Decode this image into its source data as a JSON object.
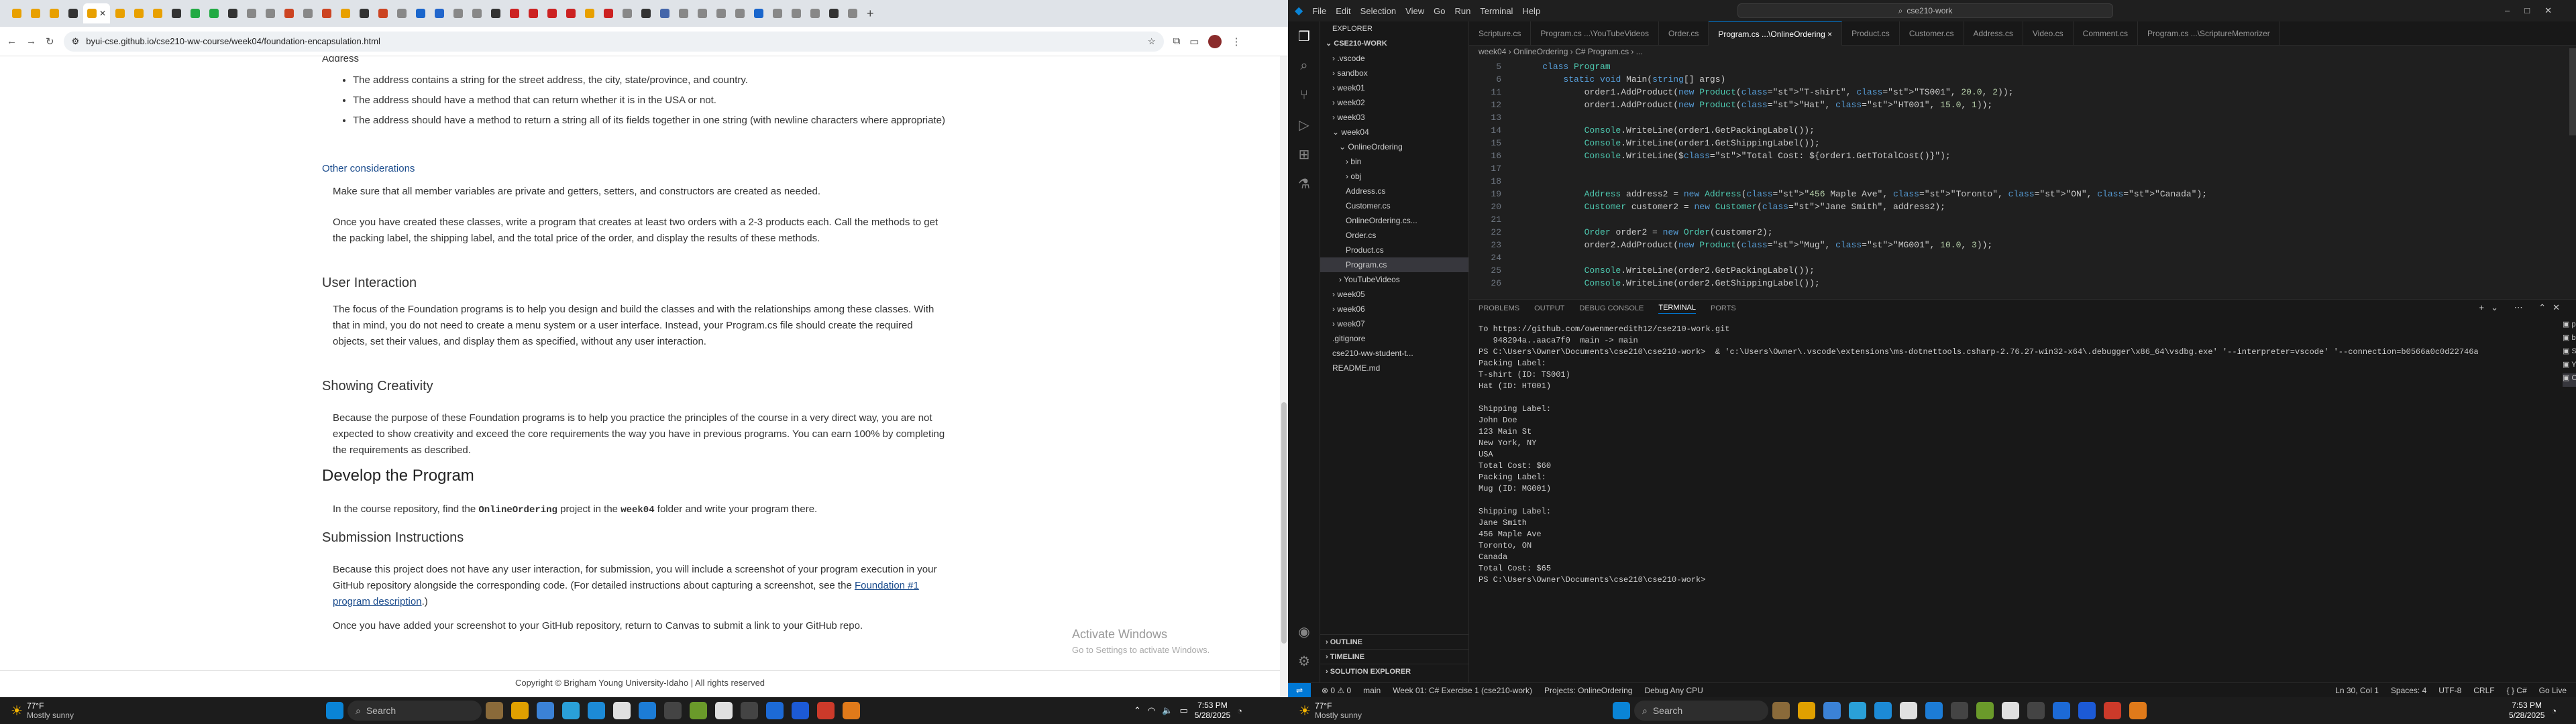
{
  "browser": {
    "url": "byui-cse.github.io/cse210-ww-course/week04/foundation-encapsulation.html",
    "tab_colors": [
      "#e8a000",
      "#e8a000",
      "#e8a000",
      "#333333",
      "#e8a000",
      "#e8a000",
      "#e8a000",
      "#e8a000",
      "#333333",
      "#22aa44",
      "#22aa44",
      "#333333",
      "#888888",
      "#888888",
      "#cc4422",
      "#888888",
      "#cc4422",
      "#e8a000",
      "#333333",
      "#cc4422",
      "#888888",
      "#1a66cc",
      "#2266cc",
      "#888888",
      "#888888",
      "#333333",
      "#cc2222",
      "#cc2222",
      "#cc2222",
      "#cc2222",
      "#e8a000",
      "#cc2222",
      "#888888",
      "#333333",
      "#4466aa",
      "#888888",
      "#888888",
      "#888888",
      "#888888",
      "#1a66cc",
      "#888888",
      "#888888",
      "#888888",
      "#333333",
      "#888888"
    ]
  },
  "doc": {
    "heading_address": "Address",
    "address_bullets": [
      "The address contains a string for the street address, the city, state/province, and country.",
      "The address should have a method that can return whether it is in the USA or not.",
      "The address should have a method to return a string all of its fields together in one string (with newline characters where appropriate)"
    ],
    "other_considerations": "Other considerations",
    "other_p1": "Make sure that all member variables are private and getters, setters, and constructors are created as needed.",
    "other_p2": "Once you have created these classes, write a program that creates at least two orders with a 2-3 products each. Call the methods to get the packing label, the shipping label, and the total price of the order, and display the results of these methods.",
    "user_interaction": "User Interaction",
    "ui_p": "The focus of the Foundation programs is to help you design and build the classes and with the relationships among these classes. With that in mind, you do not need to create a menu system or a user interface. Instead, your Program.cs file should create the required objects, set their values, and display them as specified, without any user interaction.",
    "showing_creativity": "Showing Creativity",
    "sc_p": "Because the purpose of these Foundation programs is to help you practice the principles of the course in a very direct way, you are not expected to show creativity and exceed the core requirements the way you have in previous programs. You can earn 100% by completing the requirements as described.",
    "develop": "Develop the Program",
    "dev_p_a": "In the course repository, find the ",
    "dev_code1": "OnlineOrdering",
    "dev_p_b": " project in the ",
    "dev_code2": "week04",
    "dev_p_c": " folder and write your program there.",
    "submission": "Submission Instructions",
    "sub_p1_a": "Because this project does not have any user interaction, for submission, you will include a screenshot of your program execution in your GitHub repository alongside the corresponding code. (For detailed instructions about capturing a screenshot, see the ",
    "sub_p1_link": "Foundation #1 program description",
    "sub_p1_c": ".)",
    "sub_p2": "Once you have added your screenshot to your GitHub repository, return to Canvas to submit a link to your GitHub repo.",
    "footer": "Copyright © Brigham Young University-Idaho | All rights reserved",
    "watermark_title": "Activate Windows",
    "watermark_sub": "Go to Settings to activate Windows."
  },
  "vscode": {
    "menu": [
      "File",
      "Edit",
      "Selection",
      "View",
      "Go",
      "Run",
      "Terminal",
      "Help"
    ],
    "command_center": "cse210-work",
    "explorer_title": "EXPLORER",
    "root": "CSE210-WORK",
    "tree": [
      {
        "label": "› .vscode",
        "indent": 1
      },
      {
        "label": "› sandbox",
        "indent": 1
      },
      {
        "label": "› week01",
        "indent": 1
      },
      {
        "label": "› week02",
        "indent": 1
      },
      {
        "label": "› week03",
        "indent": 1
      },
      {
        "label": "⌄ week04",
        "indent": 1
      },
      {
        "label": "⌄ OnlineOrdering",
        "indent": 2
      },
      {
        "label": "› bin",
        "indent": 3
      },
      {
        "label": "› obj",
        "indent": 3
      },
      {
        "label": "Address.cs",
        "indent": 3
      },
      {
        "label": "Customer.cs",
        "indent": 3
      },
      {
        "label": "OnlineOrdering.cs...",
        "indent": 3
      },
      {
        "label": "Order.cs",
        "indent": 3
      },
      {
        "label": "Product.cs",
        "indent": 3
      },
      {
        "label": "Program.cs",
        "indent": 3,
        "selected": true
      },
      {
        "label": "› YouTubeVideos",
        "indent": 2
      },
      {
        "label": "› week05",
        "indent": 1
      },
      {
        "label": "› week06",
        "indent": 1
      },
      {
        "label": "› week07",
        "indent": 1
      },
      {
        "label": ".gitignore",
        "indent": 1
      },
      {
        "label": "cse210-ww-student-t...",
        "indent": 1
      },
      {
        "label": "README.md",
        "indent": 1
      }
    ],
    "outline": [
      "› OUTLINE",
      "› TIMELINE",
      "› SOLUTION EXPLORER"
    ],
    "tabs": [
      "Scripture.cs",
      "Program.cs ...\\YouTubeVideos",
      "Order.cs",
      "Program.cs ...\\OnlineOrdering ×",
      "Product.cs",
      "Customer.cs",
      "Address.cs",
      "Video.cs",
      "Comment.cs",
      "Program.cs ...\\ScriptureMemorizer"
    ],
    "breadcrumb": "week04 › OnlineOrdering › C# Program.cs › ...",
    "code": [
      {
        "n": "5",
        "t": "    class Program"
      },
      {
        "n": "6",
        "t": "        static void Main(string[] args)"
      },
      {
        "n": "11",
        "t": "            order1.AddProduct(new Product(\"T-shirt\", \"TS001\", 20.0, 2));"
      },
      {
        "n": "12",
        "t": "            order1.AddProduct(new Product(\"Hat\", \"HT001\", 15.0, 1));"
      },
      {
        "n": "13",
        "t": ""
      },
      {
        "n": "14",
        "t": "            Console.WriteLine(order1.GetPackingLabel());"
      },
      {
        "n": "15",
        "t": "            Console.WriteLine(order1.GetShippingLabel());"
      },
      {
        "n": "16",
        "t": "            Console.WriteLine($\"Total Cost: ${order1.GetTotalCost()}\");"
      },
      {
        "n": "17",
        "t": ""
      },
      {
        "n": "18",
        "t": ""
      },
      {
        "n": "19",
        "t": "            Address address2 = new Address(\"456 Maple Ave\", \"Toronto\", \"ON\", \"Canada\");"
      },
      {
        "n": "20",
        "t": "            Customer customer2 = new Customer(\"Jane Smith\", address2);"
      },
      {
        "n": "21",
        "t": ""
      },
      {
        "n": "22",
        "t": "            Order order2 = new Order(customer2);"
      },
      {
        "n": "23",
        "t": "            order2.AddProduct(new Product(\"Mug\", \"MG001\", 10.0, 3));"
      },
      {
        "n": "24",
        "t": ""
      },
      {
        "n": "25",
        "t": "            Console.WriteLine(order2.GetPackingLabel());"
      },
      {
        "n": "26",
        "t": "            Console.WriteLine(order2.GetShippingLabel());"
      }
    ],
    "panel_tabs": [
      "PROBLEMS",
      "OUTPUT",
      "DEBUG CONSOLE",
      "TERMINAL",
      "PORTS"
    ],
    "terminal": [
      "To https://github.com/owenmeredith12/cse210-work.git",
      "   948294a..aaca7f0  main -> main",
      "PS C:\\Users\\Owner\\Documents\\cse210\\cse210-work>  & 'c:\\Users\\Owner\\.vscode\\extensions\\ms-dotnettools.csharp-2.76.27-win32-x64\\.debugger\\x86_64\\vsdbg.exe' '--interpreter=vscode' '--connection=b0566a0c0d22746a3bd660bdef719a232'",
      "Packing Label:",
      "T-shirt (ID: TS001)",
      "Hat (ID: HT001)",
      "",
      "Shipping Label:",
      "John Doe",
      "123 Main St",
      "New York, NY",
      "USA",
      "Total Cost: $60",
      "Packing Label:",
      "Mug (ID: MG001)",
      "",
      "Shipping Label:",
      "Jane Smith",
      "456 Maple Ave",
      "Toronto, ON",
      "Canada",
      "Total Cost: $65",
      "PS C:\\Users\\Owner\\Documents\\cse210\\cse210-work> "
    ],
    "term_list": [
      "powe...",
      "b...",
      "Script...",
      "YouT...",
      "Onlin..."
    ],
    "status_left": [
      "⊗ 0 ⚠ 0",
      "main",
      "Week 01: C# Exercise 1 (cse210-work)",
      "Projects: OnlineOrdering",
      "Debug Any CPU"
    ],
    "status_right": [
      "Ln 30, Col 1",
      "Spaces: 4",
      "UTF-8",
      "CRLF",
      "{ } C#",
      "Go Live"
    ]
  },
  "taskbar": {
    "temp": "77°F",
    "weather": "Mostly sunny",
    "search": "Search",
    "time": "7:53 PM",
    "date": "5/28/2025"
  }
}
